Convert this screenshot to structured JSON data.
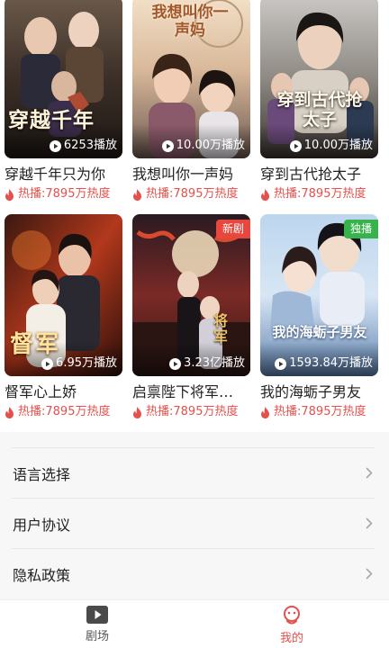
{
  "colors": {
    "accent": "#e4504b",
    "badge_new": "#e8473d",
    "badge_exclusive": "#38b24a",
    "background": "#f7f7f7"
  },
  "dramas": [
    {
      "title": "穿越千年只为你",
      "plays": "6253播放",
      "heat": "热播:7895万热度",
      "badge": "",
      "poster_text": "穿越千年"
    },
    {
      "title": "我想叫你一声妈",
      "plays": "10.00万播放",
      "heat": "热播:7895万热度",
      "badge": "",
      "poster_text": "我想叫你一声妈"
    },
    {
      "title": "穿到古代抢太子",
      "plays": "10.00万播放",
      "heat": "热播:7895万热度",
      "badge": "",
      "poster_text": "穿到古代抢太子"
    },
    {
      "title": "督军心上娇",
      "plays": "6.95万播放",
      "heat": "热播:7895万热度",
      "badge": "",
      "poster_text": "督军"
    },
    {
      "title": "启禀陛下将军…",
      "plays": "3.23亿播放",
      "heat": "热播:7895万热度",
      "badge": "新剧",
      "poster_text": "将军"
    },
    {
      "title": "我的海蛎子男友",
      "plays": "1593.84万播放",
      "heat": "热播:7895万热度",
      "badge": "独播",
      "poster_text": "我的海蛎子男友"
    }
  ],
  "settings": [
    {
      "label": "语言选择",
      "icon": "chevron-right-icon"
    },
    {
      "label": "用户协议",
      "icon": "chevron-right-icon"
    },
    {
      "label": "隐私政策",
      "icon": "chevron-right-icon"
    }
  ],
  "tabbar": {
    "theater": {
      "label": "剧场",
      "icon": "play-icon",
      "active": false
    },
    "mine": {
      "label": "我的",
      "icon": "profile-icon",
      "active": true
    }
  }
}
